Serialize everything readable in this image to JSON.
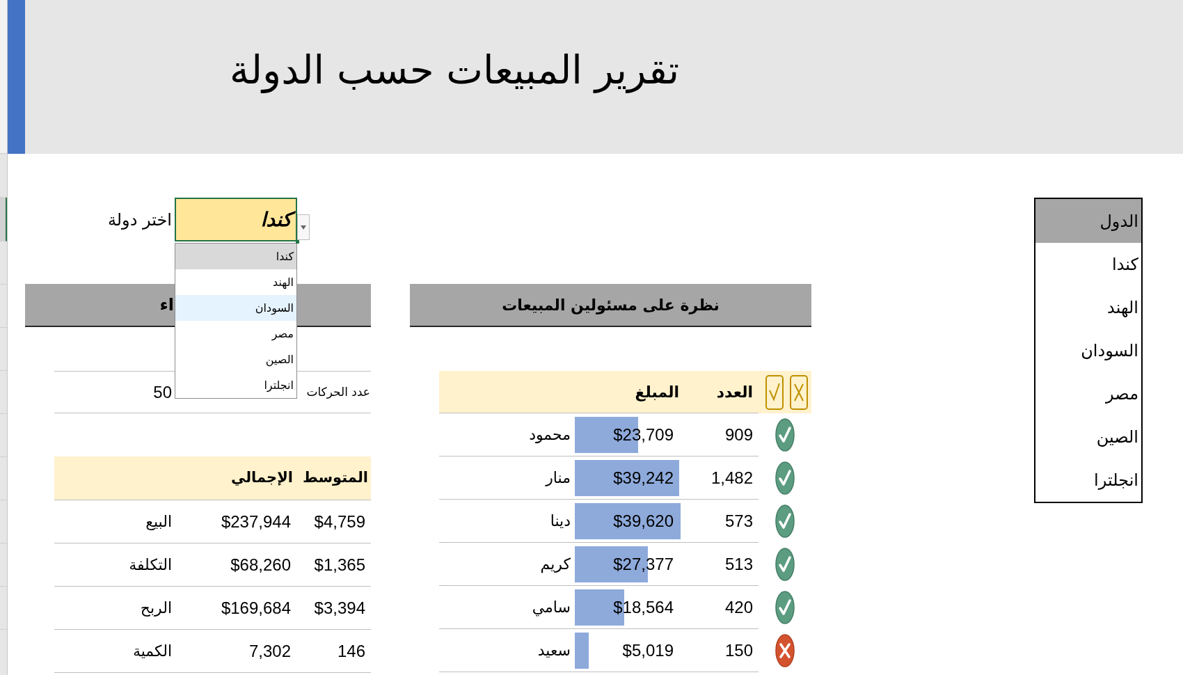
{
  "title": "تقرير المبيعات حسب الدولة",
  "country_selector": {
    "label": "اختر دولة",
    "value": "كندا",
    "options": [
      {
        "label": "كندا",
        "selected": true,
        "hovered": false
      },
      {
        "label": "الهند",
        "selected": false,
        "hovered": false
      },
      {
        "label": "السودان",
        "selected": false,
        "hovered": true
      },
      {
        "label": "مصر",
        "selected": false,
        "hovered": false
      },
      {
        "label": "الصين",
        "selected": false,
        "hovered": false
      },
      {
        "label": "انجلترا",
        "selected": false,
        "hovered": false
      }
    ]
  },
  "summary_panel": {
    "title": "اء",
    "transactions": {
      "label": "عدد الحركات",
      "value": "50"
    },
    "columns": [
      "المتوسط",
      "الإجمالي"
    ],
    "rows": [
      {
        "label": "البيع",
        "total": "$237,944",
        "average": "$4,759"
      },
      {
        "label": "التكلفة",
        "total": "$68,260",
        "average": "$1,365"
      },
      {
        "label": "الربح",
        "total": "$169,684",
        "average": "$3,394"
      },
      {
        "label": "الكمية",
        "total": "7,302",
        "average": "146"
      }
    ]
  },
  "sales_reps_panel": {
    "title": "نظرة على مسئولين المبيعات",
    "columns": {
      "count": "العدد",
      "amount": "المبلغ"
    },
    "rows": [
      {
        "name": "محمود",
        "amount": "$23,709",
        "level": 0.6,
        "count": "909",
        "passed": true
      },
      {
        "name": "منار",
        "amount": "$39,242",
        "level": 0.99,
        "count": "1,482",
        "passed": true
      },
      {
        "name": "دينا",
        "amount": "$39,620",
        "level": 1.0,
        "count": "573",
        "passed": true
      },
      {
        "name": "كريم",
        "amount": "$27,377",
        "level": 0.69,
        "count": "513",
        "passed": true
      },
      {
        "name": "سامي",
        "amount": "$18,564",
        "level": 0.47,
        "count": "420",
        "passed": true
      },
      {
        "name": "سعيد",
        "amount": "$5,019",
        "level": 0.13,
        "count": "150",
        "passed": false
      }
    ]
  },
  "countries_list": {
    "header": "الدول",
    "items": [
      "كندا",
      "الهند",
      "السودان",
      "مصر",
      "الصين",
      "انجلترا"
    ]
  }
}
